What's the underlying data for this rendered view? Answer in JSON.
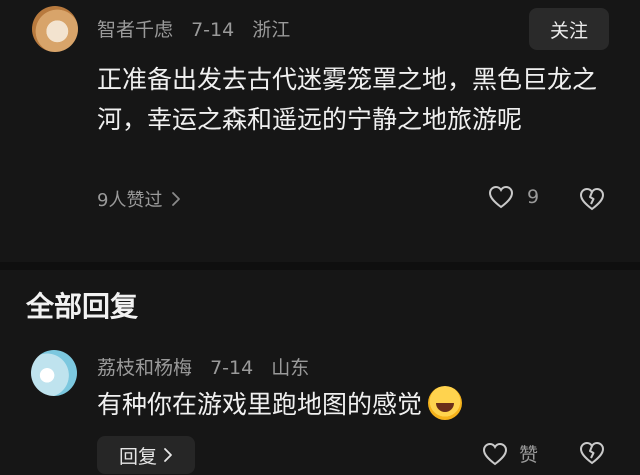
{
  "comment": {
    "username": "智者千虑",
    "date": "7-14",
    "location": "浙江",
    "follow_label": "关注",
    "text": "正准备出发去古代迷雾笼罩之地，黑色巨龙之河，幸运之森和遥远的宁静之地旅游呢",
    "likers_label": "9人赞过",
    "like_count": "9"
  },
  "section": {
    "title": "全部回复"
  },
  "reply": {
    "username": "荔枝和杨梅",
    "date": "7-14",
    "location": "山东",
    "text": "有种你在游戏里跑地图的感觉",
    "reply_label": "回复",
    "like_label": "赞"
  },
  "icons": {
    "chevron": "chevron-right-icon",
    "heart": "heart-outline-icon",
    "dislike": "broken-heart-icon",
    "emoji": "laughing-tears-emoji"
  }
}
